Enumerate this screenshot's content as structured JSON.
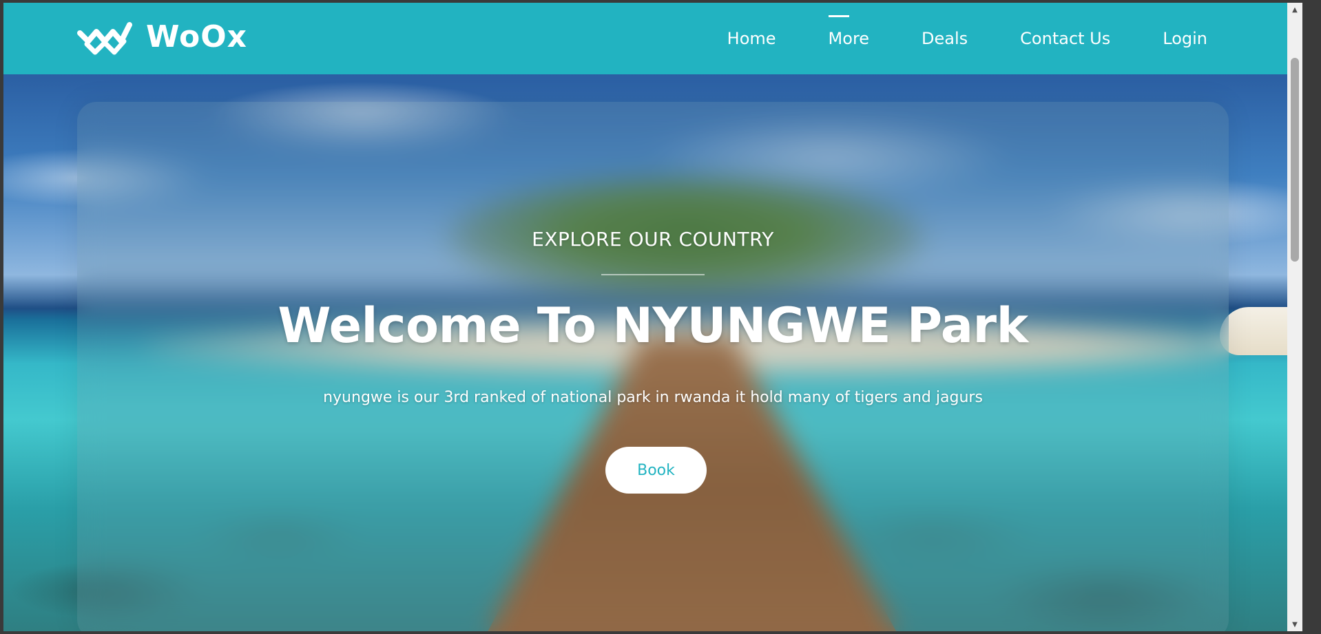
{
  "brand": {
    "name": "WoOx",
    "logo_icon": "double-chevron-w-logo-icon"
  },
  "nav": {
    "items": [
      {
        "label": "Home"
      },
      {
        "label": "More",
        "active": true
      },
      {
        "label": "Deals"
      },
      {
        "label": "Contact Us"
      },
      {
        "label": "Login"
      }
    ]
  },
  "hero": {
    "eyebrow": "EXPLORE OUR COUNTRY",
    "title": "Welcome To NYUNGWE Park",
    "subtitle": "nyungwe is our 3rd ranked of national park in rwanda it hold many of tigers and jagurs",
    "book_label": "Book"
  },
  "colors": {
    "header_bg": "#22b3c1",
    "accent": "#22b3c1",
    "button_bg": "#ffffff",
    "text": "#ffffff"
  }
}
